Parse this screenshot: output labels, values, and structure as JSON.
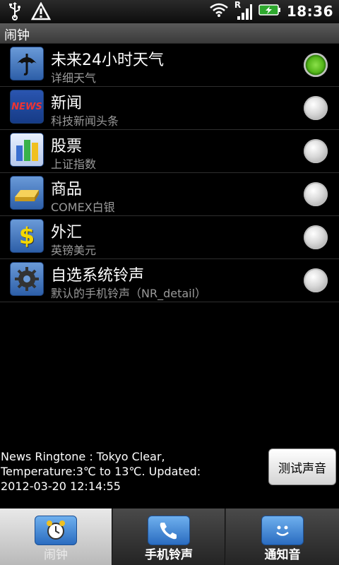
{
  "status_bar": {
    "time": "18:36",
    "roaming_indicator": "R",
    "icons": [
      "usb-icon",
      "warning-icon",
      "wifi-icon",
      "signal-icon",
      "battery-charging-icon"
    ]
  },
  "title_bar": {
    "title": "闹钟"
  },
  "list": {
    "items": [
      {
        "title": "未来24小时天气",
        "subtitle": "详细天气",
        "icon": "umbrella-icon",
        "selected": true
      },
      {
        "title": "新闻",
        "subtitle": "科技新闻头条",
        "icon": "news-icon",
        "icon_text": "NEWS",
        "selected": false
      },
      {
        "title": "股票",
        "subtitle": "上证指数",
        "icon": "stock-chart-icon",
        "selected": false
      },
      {
        "title": "商品",
        "subtitle": "COMEX白银",
        "icon": "gold-bar-icon",
        "selected": false
      },
      {
        "title": "外汇",
        "subtitle": "英镑美元",
        "icon": "dollar-icon",
        "icon_text": "$",
        "selected": false
      },
      {
        "title": "自选系统铃声",
        "subtitle": "默认的手机铃声（NR_detail）",
        "icon": "gear-icon",
        "selected": false
      }
    ]
  },
  "info": {
    "lines": [
      "News Ringtone : Tokyo  Clear,",
      "Temperature:3℃ to 13℃. Updated:",
      "2012-03-20 12:14:55"
    ],
    "test_button_label": "测试声音"
  },
  "tabs": [
    {
      "label": "闹钟",
      "icon": "alarm-clock-icon",
      "active": true
    },
    {
      "label": "手机铃声",
      "icon": "phone-icon",
      "active": false
    },
    {
      "label": "通知音",
      "icon": "smiley-icon",
      "active": false
    }
  ],
  "colors": {
    "selected_radio": "#54b61a",
    "icon_blue": "#2d5fa8",
    "subtitle_gray": "#9a9a9a"
  }
}
